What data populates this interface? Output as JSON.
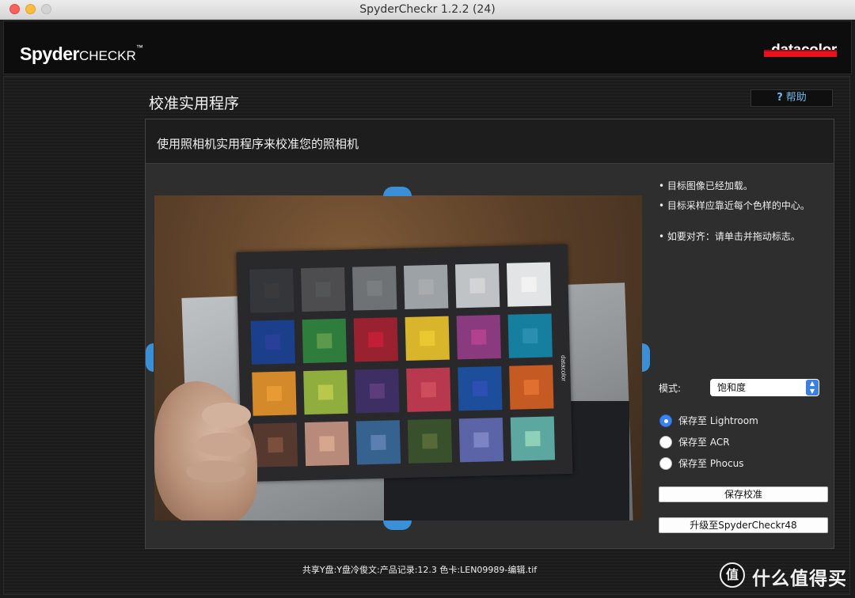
{
  "window": {
    "title": "SpyderCheckr 1.2.2 (24)"
  },
  "header": {
    "brand_main": "Spyder",
    "brand_sub": "CHECKR",
    "brand_tm": "™",
    "vendor": "datacolor",
    "vendor_color": "#e8121f"
  },
  "page": {
    "title": "校准实用程序",
    "help_label": "帮助",
    "help_icon": "?",
    "subtitle": "使用照相机实用程序来校准您的照相机"
  },
  "card": {
    "brand": "datacolor",
    "swatches": [
      [
        "#35363a",
        "#4d4d4f",
        "#6f7275",
        "#9da2a6",
        "#bfc3c6",
        "#e2e4e5"
      ],
      [
        "#1c3f8c",
        "#2f7d3d",
        "#9a2230",
        "#d8b52a",
        "#8a3a7e",
        "#167fa0"
      ],
      [
        "#d48a2a",
        "#8fae3d",
        "#3d2e63",
        "#b8394d",
        "#1c4e9c",
        "#c55a23"
      ],
      [
        "#55392f",
        "#b78a7a",
        "#35628f",
        "#38502c",
        "#5a64a6",
        "#5ca8a0"
      ]
    ],
    "inner": [
      [
        "#3a3a3d",
        "#545556",
        "#7b7e81",
        "#a8acaf",
        "#d2d4d5",
        "#f2f2f2"
      ],
      [
        "#2a3f9a",
        "#5b9a4d",
        "#c21f36",
        "#eac930",
        "#b24290",
        "#2a8eb0"
      ],
      [
        "#e89a34",
        "#b9c84a",
        "#5a3d7a",
        "#cf4c5d",
        "#2d4fb4",
        "#e07030"
      ],
      [
        "#7a4f3c",
        "#d7a68f",
        "#5b7fb0",
        "#556a36",
        "#7d84c4",
        "#8fd0b8"
      ]
    ]
  },
  "info": {
    "bullets": [
      "• 目标图像已经加载。",
      "• 目标采样应靠近每个色样的中心。",
      "• 如要对齐：请单击并拖动标志。"
    ],
    "mode_label": "模式:",
    "mode_value": "饱和度",
    "radios": [
      {
        "label": "保存至 Lightroom",
        "selected": true
      },
      {
        "label": "保存至 ACR",
        "selected": false
      },
      {
        "label": "保存至 Phocus",
        "selected": false
      }
    ],
    "save_button": "保存校准",
    "upgrade_button": "升级至SpyderCheckr48"
  },
  "status_path": "共享Y盘:Y盘冷俊文:产品记录:12.3 色卡:LEN09989-编辑.tif",
  "watermark": {
    "icon": "值",
    "text": "什么值得买"
  },
  "accent_color": "#3b8fd6"
}
